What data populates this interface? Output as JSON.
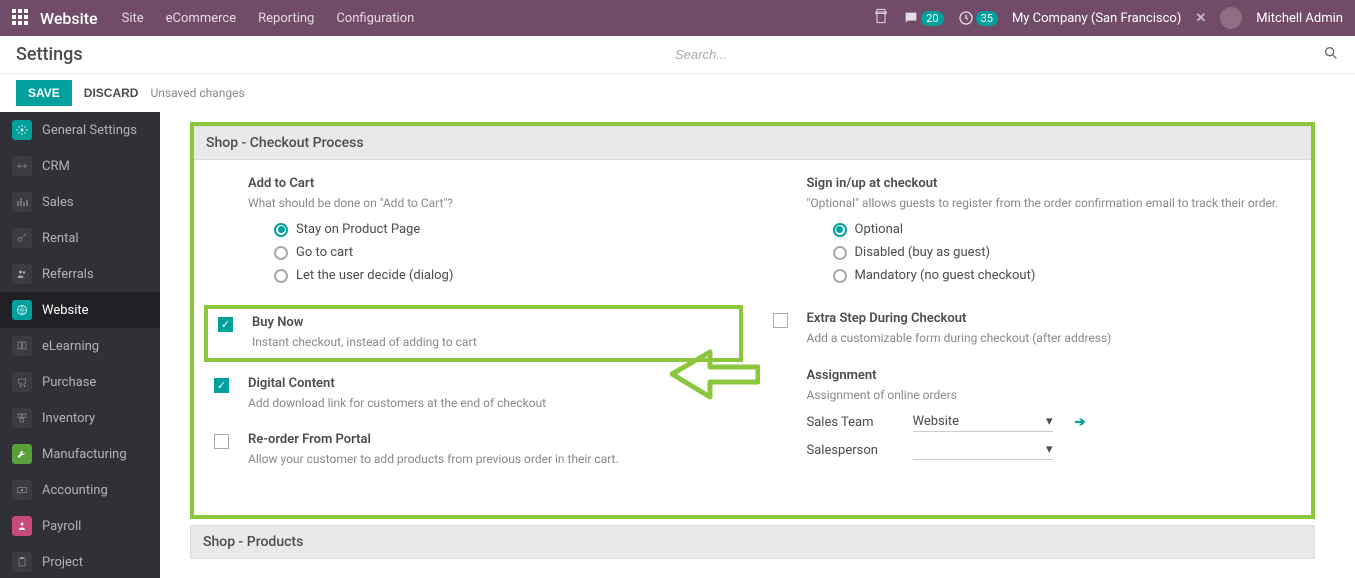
{
  "topbar": {
    "brand": "Website",
    "menu": [
      "Site",
      "eCommerce",
      "Reporting",
      "Configuration"
    ],
    "discuss_badge": "20",
    "activity_badge": "35",
    "company": "My Company (San Francisco)",
    "user": "Mitchell Admin"
  },
  "header": {
    "title": "Settings",
    "search_placeholder": "Search..."
  },
  "actions": {
    "save": "SAVE",
    "discard": "DISCARD",
    "status": "Unsaved changes"
  },
  "sidebar": {
    "items": [
      {
        "label": "General Settings"
      },
      {
        "label": "CRM"
      },
      {
        "label": "Sales"
      },
      {
        "label": "Rental"
      },
      {
        "label": "Referrals"
      },
      {
        "label": "Website",
        "active": true
      },
      {
        "label": "eLearning"
      },
      {
        "label": "Purchase"
      },
      {
        "label": "Inventory"
      },
      {
        "label": "Manufacturing"
      },
      {
        "label": "Accounting"
      },
      {
        "label": "Payroll"
      },
      {
        "label": "Project"
      }
    ]
  },
  "sections": {
    "checkout": {
      "title": "Shop - Checkout Process",
      "add_to_cart": {
        "title": "Add to Cart",
        "desc": "What should be done on \"Add to Cart\"?",
        "options": [
          "Stay on Product Page",
          "Go to cart",
          "Let the user decide (dialog)"
        ],
        "selected": 0
      },
      "sign_in": {
        "title": "Sign in/up at checkout",
        "desc": "\"Optional\" allows guests to register from the order confirmation email to track their order.",
        "options": [
          "Optional",
          "Disabled (buy as guest)",
          "Mandatory (no guest checkout)"
        ],
        "selected": 0
      },
      "buy_now": {
        "title": "Buy Now",
        "desc": "Instant checkout, instead of adding to cart",
        "checked": true
      },
      "extra_step": {
        "title": "Extra Step During Checkout",
        "desc": "Add a customizable form during checkout (after address)",
        "checked": false
      },
      "digital": {
        "title": "Digital Content",
        "desc": "Add download link for customers at the end of checkout",
        "checked": true
      },
      "assignment": {
        "title": "Assignment",
        "desc": "Assignment of online orders",
        "sales_team_label": "Sales Team",
        "sales_team_value": "Website",
        "salesperson_label": "Salesperson",
        "salesperson_value": ""
      },
      "reorder": {
        "title": "Re-order From Portal",
        "desc": "Allow your customer to add products from previous order in their cart.",
        "checked": false
      }
    },
    "products": {
      "title": "Shop - Products"
    }
  }
}
